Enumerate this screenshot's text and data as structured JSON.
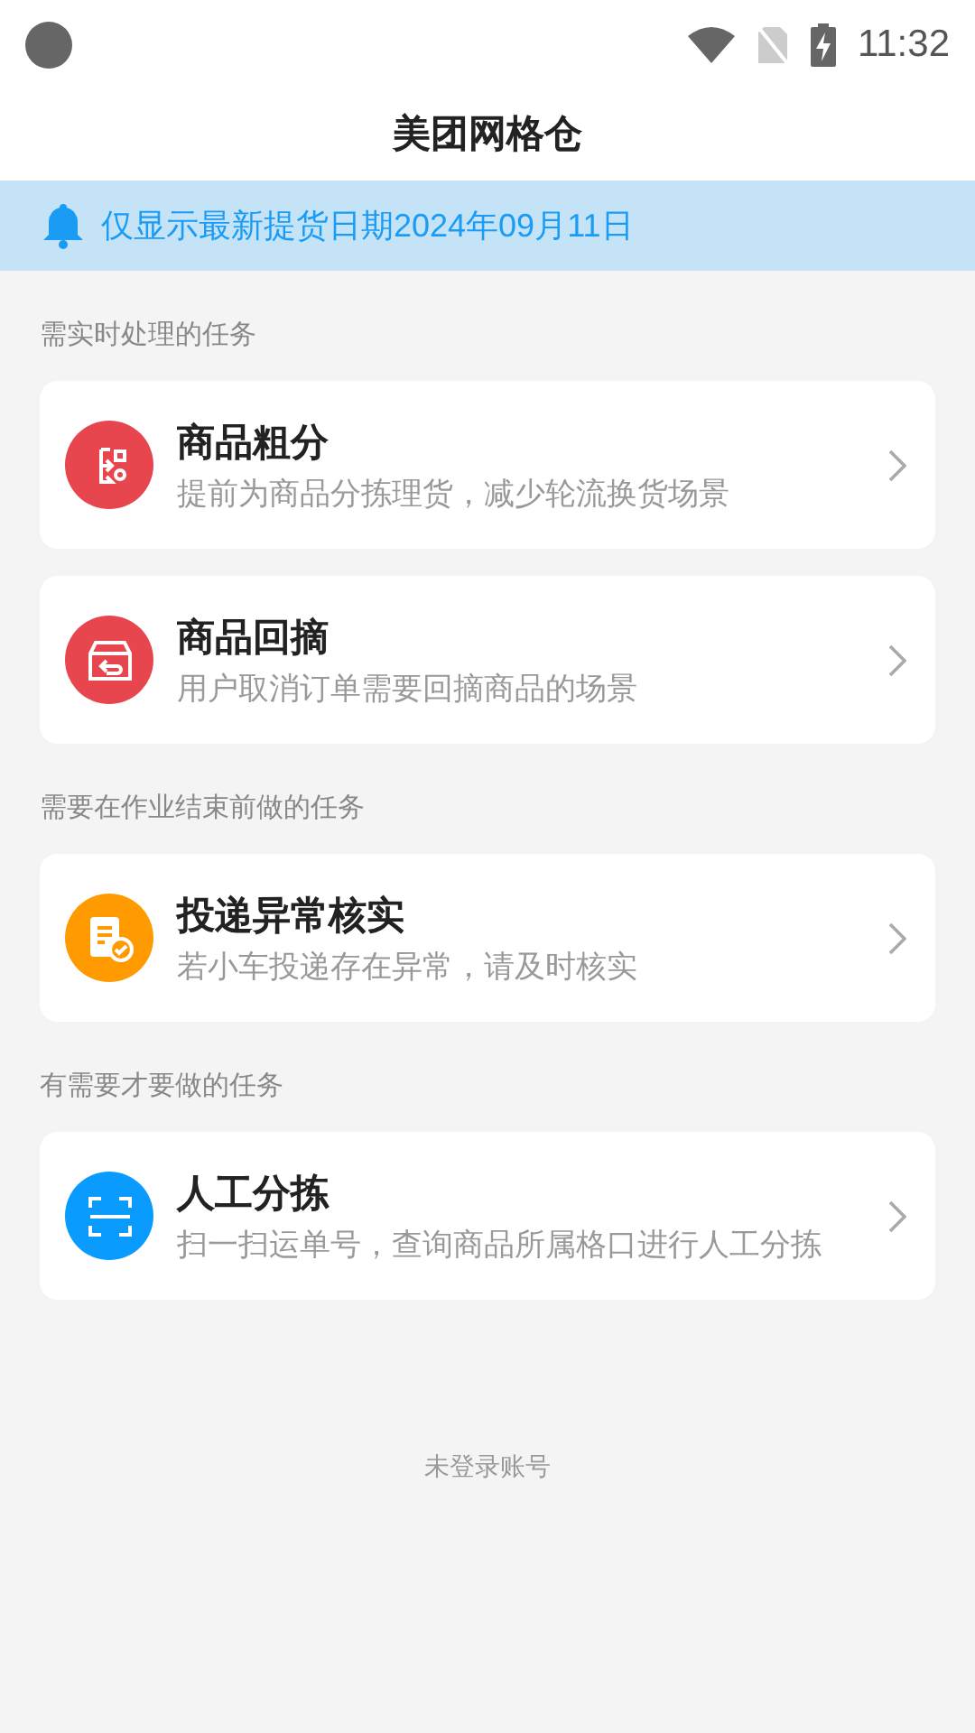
{
  "status_bar": {
    "time": "11:32"
  },
  "header": {
    "title": "美团网格仓"
  },
  "notice": {
    "text": "仅显示最新提货日期2024年09月11日"
  },
  "sections": [
    {
      "title": "需实时处理的任务",
      "tasks": [
        {
          "kind": "split",
          "color": "#e8464f",
          "title": "商品粗分",
          "description": "提前为商品分拣理货，减少轮流换货场景"
        },
        {
          "kind": "return",
          "color": "#e8464f",
          "title": "商品回摘",
          "description": "用户取消订单需要回摘商品的场景"
        }
      ]
    },
    {
      "title": "需要在作业结束前做的任务",
      "tasks": [
        {
          "kind": "verify",
          "color": "#ff9a00",
          "title": "投递异常核实",
          "description": "若小车投递存在异常，请及时核实"
        }
      ]
    },
    {
      "title": "有需要才要做的任务",
      "tasks": [
        {
          "kind": "scan",
          "color": "#0a9bff",
          "title": "人工分拣",
          "description": "扫一扫运单号，查询商品所属格口进行人工分拣"
        }
      ]
    }
  ],
  "footer": {
    "text": "未登录账号"
  }
}
